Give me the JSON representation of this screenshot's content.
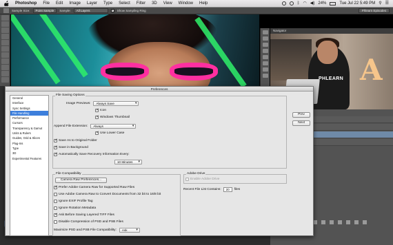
{
  "menubar": {
    "app": "Photoshop",
    "items": [
      "File",
      "Edit",
      "Image",
      "Layer",
      "Type",
      "Select",
      "Filter",
      "3D",
      "View",
      "Window",
      "Help"
    ],
    "battery": "24%",
    "clock": "Tue Jul 22  5:49 PM"
  },
  "options_bar": {
    "sample_size_label": "Sample Size:",
    "sample_size_value": "Point Sample",
    "sample_label": "Sample:",
    "sample_value": "All Layers",
    "show_ring_label": "Show Sampling Ring",
    "workspace": "Phlearn Episodes"
  },
  "navigator": {
    "title": "Navigator"
  },
  "video_overlay": {
    "shirt_text": "PHLEARN",
    "letter": "A"
  },
  "dialog": {
    "title": "Preferences",
    "categories": [
      "General",
      "Interface",
      "Sync Settings",
      "File Handling",
      "Performance",
      "Cursors",
      "Transparency & Gamut",
      "Units & Rulers",
      "Guides, Grid & Slices",
      "Plug-Ins",
      "Type",
      "3D",
      "Experimental Features"
    ],
    "selected_category": "File Handling",
    "file_saving": {
      "title": "File Saving Options",
      "image_previews_label": "Image Previews:",
      "image_previews_value": "Always Save",
      "icon_label": "Icon",
      "windows_thumb_label": "Windows Thumbnail",
      "append_ext_label": "Append File Extension:",
      "append_ext_value": "Always",
      "lower_case_label": "Use Lower Case",
      "save_as_original_label": "Save As to Original Folder",
      "save_in_background_label": "Save in Background",
      "auto_save_label": "Automatically Save Recovery Information Every:",
      "auto_save_value": "10 Minutes"
    },
    "file_compat": {
      "title": "File Compatibility",
      "camera_raw_button": "Camera Raw Preferences...",
      "prefer_acr_label": "Prefer Adobe Camera Raw for Supported Raw Files",
      "use_acr_convert_label": "Use Adobe Camera Raw to Convert Documents from 32 bit to 16/8 bit",
      "ignore_exif_label": "Ignore EXIF Profile Tag",
      "ignore_rotation_label": "Ignore Rotation Metadata",
      "ask_tiff_label": "Ask Before Saving Layered TIFF Files",
      "disable_compression_label": "Disable Compression of PSD and PSB Files",
      "maximize_label": "Maximize PSD and PSB File Compatibility:",
      "maximize_value": "Ask"
    },
    "adobe_drive": {
      "title": "Adobe Drive",
      "enable_label": "Enable Adobe Drive"
    },
    "recent_files": {
      "label": "Recent File List Contains:",
      "value": "20",
      "unit": "files"
    },
    "buttons": {
      "prev": "Prev",
      "next": "Next"
    }
  },
  "colors": {
    "selection_blue": "#3d7fdc",
    "glasses_pink": "#ff2fa0",
    "ps_panel": "#535353"
  }
}
